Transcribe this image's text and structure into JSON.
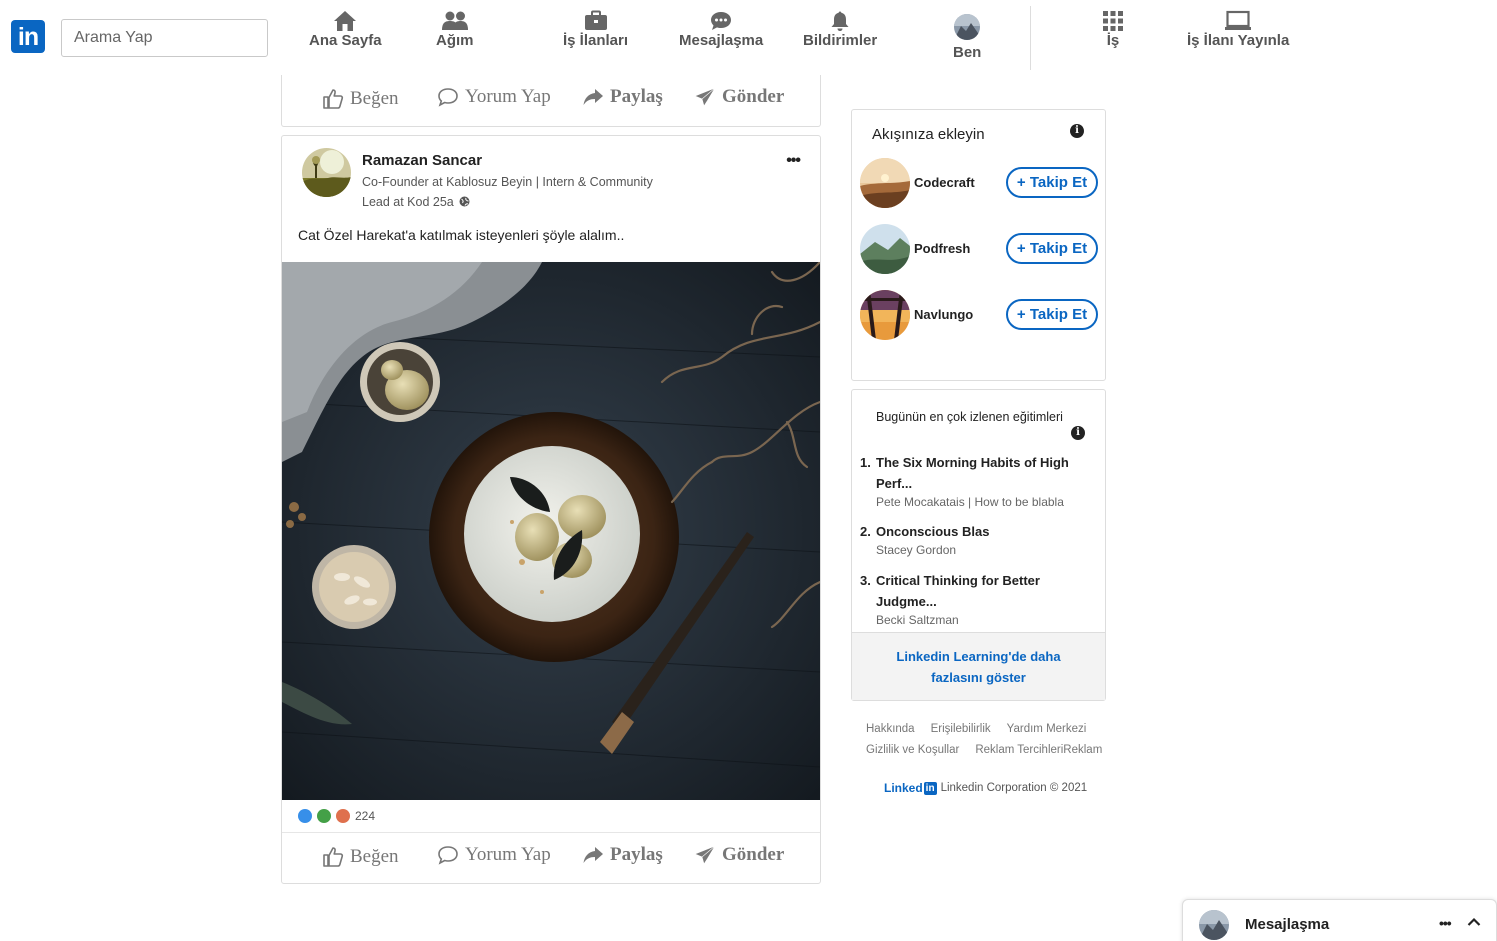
{
  "nav": {
    "logo_text": "in",
    "search_placeholder": "Arama Yap",
    "items": [
      {
        "label": "Ana Sayfa",
        "icon": "home-icon"
      },
      {
        "label": "Ağım",
        "icon": "network-icon"
      },
      {
        "label": "İş İlanları",
        "icon": "briefcase-icon"
      },
      {
        "label": "Mesajlaşma",
        "icon": "chat-icon"
      },
      {
        "label": "Bildirimler",
        "icon": "bell-icon"
      },
      {
        "label": "Ben",
        "icon": "avatar"
      },
      {
        "label": "İş",
        "icon": "grid-icon"
      },
      {
        "label": "İş İlanı Yayınla",
        "icon": "laptop-icon"
      }
    ]
  },
  "post_actions": {
    "like": "Beğen",
    "comment": "Yorum Yap",
    "share": "Paylaş",
    "send": "Gönder"
  },
  "post": {
    "author_name": "Ramazan Sancar",
    "author_headline": "Co-Founder at Kablosuz Beyin | Intern & Community",
    "author_meta": "Lead at Kod 25a",
    "text": "Cat Özel Harekat'a katılmak isteyenleri şöyle alalım..",
    "reaction_count": "224"
  },
  "follow": {
    "title": "Akışınıza ekleyin",
    "button_label": "+ Takip Et",
    "items": [
      {
        "name": "Codecraft"
      },
      {
        "name": "Podfresh"
      },
      {
        "name": "Navlungo"
      }
    ]
  },
  "learning": {
    "title": "Bugünün en çok izlenen eğitimleri",
    "courses": [
      {
        "num": "1.",
        "title": "The Six Morning Habits of High Perf...",
        "author": "Pete Mocakatais | How to be blabla"
      },
      {
        "num": "2.",
        "title": "Onconscious Blas",
        "author": "Stacey Gordon"
      },
      {
        "num": "3.",
        "title": "Critical Thinking for Better Judgme...",
        "author": "Becki Saltzman"
      }
    ],
    "more_link": "Linkedin Learning'de daha fazlasını göster"
  },
  "footer": {
    "links_row1": [
      "Hakkında",
      "Erişilebilirlik",
      "Yardım Merkezi"
    ],
    "links_row2": [
      "Gizlilik ve Koşullar",
      "Reklam TercihleriReklam"
    ],
    "brand": "Linked",
    "brand_in": "in",
    "copyright": "Linkedin Corporation © 2021"
  },
  "messaging": {
    "title": "Mesajlaşma"
  },
  "colors": {
    "accent": "#0a66c2",
    "text": "#222222",
    "muted": "#777777"
  }
}
